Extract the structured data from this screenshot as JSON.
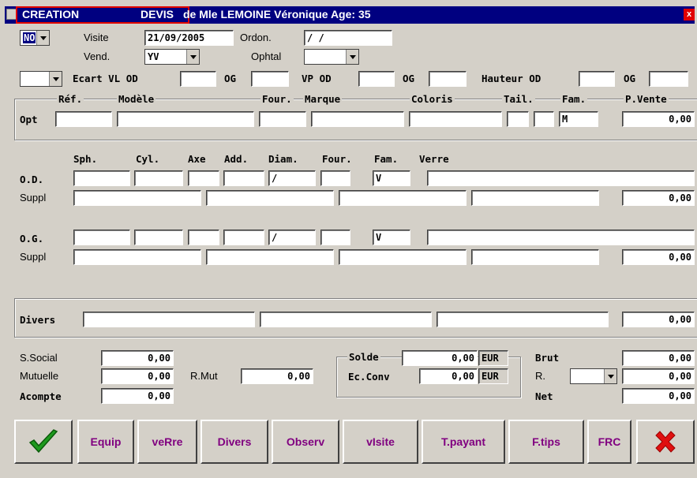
{
  "title": {
    "creation": "CREATION",
    "devis": "DEVIS",
    "rest": " de  Mle LEMOINE Véronique  Age: 35",
    "close": "x"
  },
  "header": {
    "type_select": "NO",
    "visite_label": "Visite",
    "visite_value": "21/09/2005",
    "ordon_label": "Ordon.",
    "ordon_value": "  /  /",
    "vend_label": "Vend.",
    "vend_value": "YV",
    "ophtal_label": "Ophtal",
    "ophtal_value": ""
  },
  "ecart": {
    "select_value": "",
    "ecart_vl_od": "Ecart VL OD",
    "og1": "OG",
    "vp_od": "VP OD",
    "og2": "OG",
    "hauteur_od": "Hauteur OD",
    "og3": "OG"
  },
  "monture": {
    "headers": {
      "ref": "Réf.",
      "modele": "Modèle",
      "four": "Four.",
      "marque": "Marque",
      "coloris": "Coloris",
      "tail": "Tail.",
      "fam": "Fam.",
      "pvente": "P.Vente"
    },
    "row_label": "Opt",
    "fam_value": "M",
    "price": "0,00"
  },
  "verres": {
    "headers": {
      "sph": "Sph.",
      "cyl": "Cyl.",
      "axe": "Axe",
      "add": "Add.",
      "diam": "Diam.",
      "four": "Four.",
      "fam": "Fam.",
      "verre": "Verre"
    },
    "od_label": "O.D.",
    "og_label": "O.G.",
    "suppl_label": "Suppl",
    "od_fam": "V",
    "og_fam": "V",
    "slash": "/",
    "od_suppl_price": "0,00",
    "og_suppl_price": "0,00"
  },
  "divers": {
    "label": "Divers",
    "price": "0,00"
  },
  "totals": {
    "ssocial_label": "S.Social",
    "ssocial": "0,00",
    "mutuelle_label": "Mutuelle",
    "mutuelle": "0,00",
    "rmut_label": "R.Mut",
    "rmut": "0,00",
    "acompte_label": "Acompte",
    "acompte": "0,00",
    "solde_label": "Solde",
    "solde": "0,00",
    "solde_cur": "EUR",
    "ecconv_label": "Ec.Conv",
    "ecconv": "0,00",
    "ecconv_cur": "EUR",
    "brut_label": "Brut",
    "brut": "0,00",
    "r_label": "R.",
    "r_value": "0,00",
    "net_label": "Net",
    "net": "0,00"
  },
  "buttons": {
    "equip": "Equip",
    "verre": "veRre",
    "divers": "Divers",
    "observ": "Observ",
    "visite": "vIsite",
    "tpayant": "T.payant",
    "ftips": "F.tips",
    "frc": "FRC"
  }
}
